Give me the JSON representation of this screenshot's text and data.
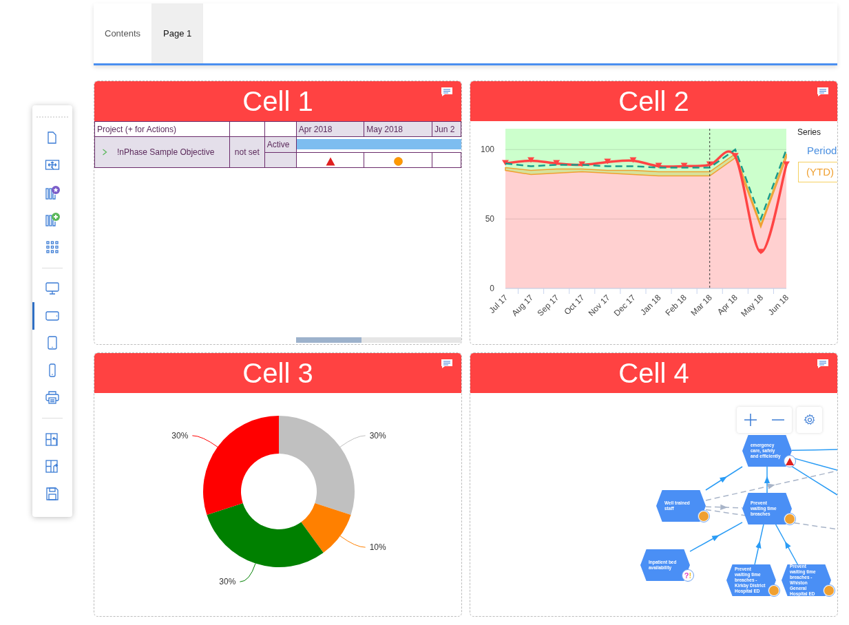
{
  "tabs": [
    {
      "label": "Contents",
      "selected": false
    },
    {
      "label": "Page 1",
      "selected": true
    }
  ],
  "toolbar": {
    "groups": [
      {
        "items": [
          {
            "selected": false
          },
          {
            "selected": false
          },
          {
            "selected": false
          },
          {
            "selected": false
          },
          {
            "selected": false
          }
        ]
      },
      {
        "items": [
          {
            "selected": false
          },
          {
            "selected": true
          },
          {
            "selected": false
          },
          {
            "selected": false
          },
          {
            "selected": false
          }
        ]
      },
      {
        "items": [
          {
            "selected": false
          },
          {
            "selected": false
          },
          {
            "selected": false
          }
        ]
      }
    ]
  },
  "cells": [
    {
      "kind": "gantt",
      "title": "Cell 1",
      "gantt": {
        "header": {
          "project": "Project (+ for Actions)",
          "months": [
            "Apr 2018",
            "May 2018",
            "Jun 2"
          ]
        },
        "rows": [
          {
            "name": "!nPhase Sample Objective",
            "expanded": false,
            "column_2": "not set",
            "column_3": "Active",
            "markers": [
              {
                "kind": "triangle"
              },
              {
                "kind": "circle"
              },
              {
                "kind": "none"
              }
            ]
          }
        ]
      }
    },
    {
      "kind": "line_chart",
      "title": "Cell 2",
      "chart_data": {
        "type": "line",
        "categories": [
          "Jul 17",
          "Aug 17",
          "Sep 17",
          "Oct 17",
          "Nov 17",
          "Dec 17",
          "Jan 18",
          "Feb 18",
          "Mar 18",
          "Apr 18",
          "May 18",
          "Jun 18"
        ],
        "ylim": [
          0,
          115
        ],
        "yticks": [
          0,
          50,
          100
        ],
        "series": [
          {
            "name": "Period",
            "color": "#ff4444",
            "marker": "triangle",
            "values": [
              90,
              92,
              90,
              89,
              91,
              92,
              88,
              88,
              89,
              95,
              26,
              89
            ]
          },
          {
            "color": "#1a9a8a",
            "line_style": "dashed",
            "values": [
              90,
              88,
              89,
              89,
              88,
              88,
              87,
              87,
              87,
              100,
              50,
              100
            ]
          },
          {
            "name": "(YTD)",
            "type": "area",
            "color": "#f0a030",
            "values": [
              87,
              85,
              86,
              86,
              85,
              85,
              84,
              84,
              84,
              97,
              46,
              97
            ]
          },
          {
            "type": "area",
            "color": "#ffd0d0",
            "values": [
              85,
              82,
              83,
              84,
              83,
              82,
              81,
              81,
              81,
              94,
              44,
              94
            ]
          }
        ]
      },
      "legend": {
        "title": "Series",
        "items": [
          {
            "color": "#4a8fe0",
            "boxed": false
          },
          {
            "color": "#f0a030",
            "boxed": true
          }
        ]
      }
    },
    {
      "kind": "donut",
      "title": "Cell 3",
      "chart_data": {
        "type": "donut",
        "values": [
          30,
          10,
          30,
          30
        ],
        "colors": [
          "#c0c0c0",
          "#ff8000",
          "#008000",
          "#ff0000"
        ],
        "value_labels": [
          "30%",
          "10%",
          "30%",
          "30%"
        ]
      }
    },
    {
      "kind": "strategy_map",
      "title": "Cell 4",
      "map": {
        "nodes": [
          {
            "label": "emergency care, safely and efficiently",
            "kind": "triangle"
          },
          {
            "label": "Well trained staff",
            "kind": "circle"
          },
          {
            "label": "Prevent waiting time breaches",
            "kind": "circle"
          },
          {
            "label": "Inpatient bed availability",
            "kind": "unknown",
            "status_text": "?!"
          },
          {
            "label": "Prevent waiting time breaches - Kirkby District Hospital ED",
            "kind": "circle"
          },
          {
            "label": "Prevent waiting time breaches - Whiston General Hospital ED",
            "kind": "circle"
          }
        ]
      }
    }
  ]
}
